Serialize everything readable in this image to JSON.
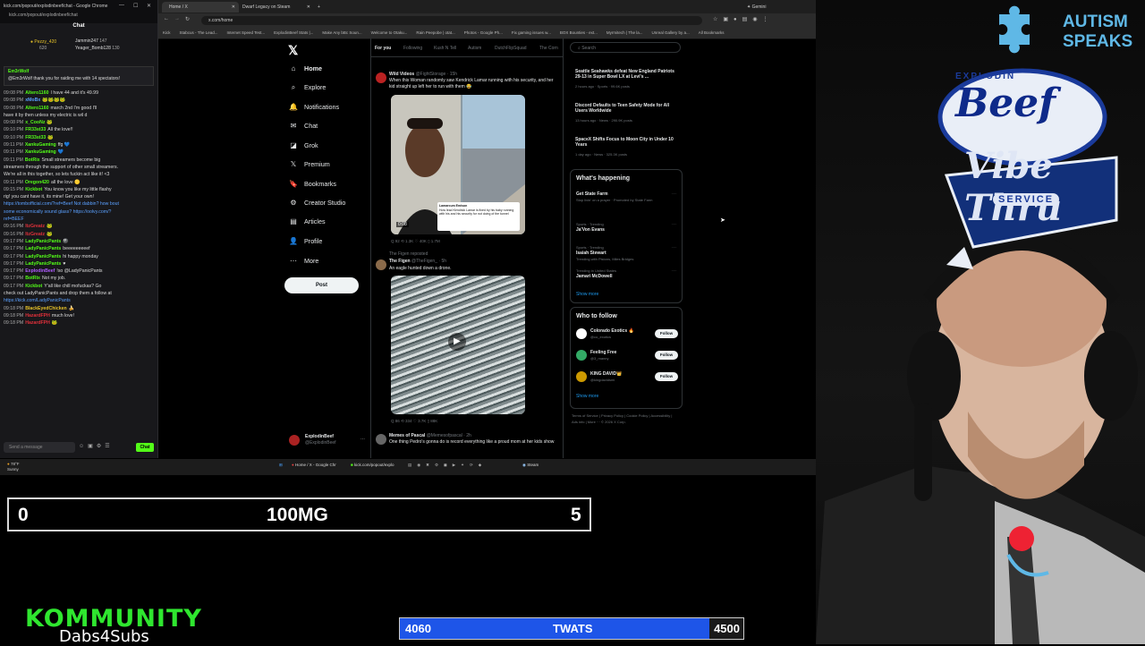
{
  "chat": {
    "window_title": "kick.com/popout/explodinbeef/chat - Google Chrome",
    "url": "kick.com/popout/explodinbeef/chat",
    "header": "Chat",
    "leaders": [
      "Pezzy_420",
      "Jammin247",
      "Yeager_Bomb128"
    ],
    "leader_counts": [
      "147",
      "130",
      "620"
    ],
    "pinned_user": "Em3rWolf",
    "pinned_text": "@Em3rWolf thank you for raiding me with 14 spectators!",
    "messages": [
      {
        "time": "09:08 PM",
        "user": "Altero1160",
        "text": "I have 44 and it's 49.99",
        "color": "#53fc18"
      },
      {
        "time": "09:08 PM",
        "user": "xMoBx",
        "text": "🐸🐸🐸🐸",
        "color": "#5aa0ff"
      },
      {
        "time": "09:08 PM",
        "user": "Altero1160",
        "text": "march 2nd I'm good I'll",
        "color": "#53fc18"
      },
      {
        "time": "",
        "user": "",
        "text": "have it by then unless my electric is wil d",
        "color": "#dcdcdc"
      },
      {
        "time": "09:08 PM",
        "user": "x_CooNz",
        "text": "🐸",
        "color": "#53fc18"
      },
      {
        "time": "09:10 PM",
        "user": "FR33st33",
        "text": "All the love!!",
        "color": "#53fc18"
      },
      {
        "time": "09:10 PM",
        "user": "FR33st33",
        "text": "🐸",
        "color": "#53fc18"
      },
      {
        "time": "09:11 PM",
        "user": "XankuGaming",
        "text": "ffg 💙",
        "color": "#53fc18"
      },
      {
        "time": "09:11 PM",
        "user": "XankuGaming",
        "text": "💙",
        "color": "#53fc18"
      },
      {
        "time": "09:11 PM",
        "user": "BotRix",
        "text": "Small streamers become big",
        "color": "#53fc18"
      },
      {
        "time": "",
        "user": "",
        "text": "streamers through the support of other small streamers.",
        "color": "#dcdcdc"
      },
      {
        "time": "",
        "user": "",
        "text": "We're all in this together, so lets fuckin act like it! <3",
        "color": "#dcdcdc"
      },
      {
        "time": "09:11 PM",
        "user": "Oregon420",
        "text": "all the love 🟡",
        "color": "#53fc18"
      },
      {
        "time": "09:15 PM",
        "user": "Kickbot",
        "text": "You know you like my little flashy",
        "color": "#53fc18"
      },
      {
        "time": "",
        "user": "",
        "text": "rig! you cant have it, its mine! Get your own!",
        "color": "#dcdcdc"
      },
      {
        "time": "",
        "user": "",
        "text": "https://tombofficial.com/?ref=Beef Not dabbin? how bout",
        "color": "#5aa0ff"
      },
      {
        "time": "",
        "user": "",
        "text": "some economically sound glass? https://oolvy.com/?",
        "color": "#5aa0ff"
      },
      {
        "time": "",
        "user": "",
        "text": "ref=BEEF",
        "color": "#5aa0ff"
      },
      {
        "time": "09:16 PM",
        "user": "ItzGreatz",
        "text": "🐸",
        "color": "#e0303a"
      },
      {
        "time": "09:16 PM",
        "user": "ItzGreatz",
        "text": "🐸",
        "color": "#e0303a"
      },
      {
        "time": "09:17 PM",
        "user": "LadyPanicPants",
        "text": "🎱",
        "color": "#53fc18"
      },
      {
        "time": "09:17 PM",
        "user": "LadyPanicPants",
        "text": "beeeeeeeeef",
        "color": "#53fc18"
      },
      {
        "time": "09:17 PM",
        "user": "LadyPanicPants",
        "text": "hi happy monday",
        "color": "#53fc18"
      },
      {
        "time": "09:17 PM",
        "user": "LadyPanicPants",
        "text": "♥",
        "color": "#53fc18"
      },
      {
        "time": "09:17 PM",
        "user": "ExplodinBeef",
        "text": "!so @LadyPanicPants",
        "color": "#b05cff"
      },
      {
        "time": "09:17 PM",
        "user": "BotRix",
        "text": "Not my job.",
        "color": "#53fc18"
      },
      {
        "time": "09:17 PM",
        "user": "Kickbot",
        "text": "Y'all like chill mofuckas? Go",
        "color": "#53fc18"
      },
      {
        "time": "",
        "user": "",
        "text": "check out LadyPanicPants and drop them a follow at",
        "color": "#dcdcdc"
      },
      {
        "time": "",
        "user": "",
        "text": "https://kick.com/LadyPanicPants",
        "color": "#5aa0ff"
      },
      {
        "time": "09:18 PM",
        "user": "BlackEyedChicken",
        "text": "🍌",
        "color": "#e6c229"
      },
      {
        "time": "09:18 PM",
        "user": "HazardFPH",
        "text": "much love!",
        "color": "#e0303a"
      },
      {
        "time": "09:18 PM",
        "user": "HazardFPH",
        "text": "🐸",
        "color": "#e0303a"
      }
    ],
    "input_placeholder": "Send a message",
    "send_label": "Chat"
  },
  "browser": {
    "tabs": [
      "Home / X",
      "Dwarf Legacy on Steam"
    ],
    "url": "x.com/home",
    "gemini_label": "Gemini",
    "bookmarks": [
      "Kick",
      "Stabcus - The Lead...",
      "Internet Speed Test...",
      "ExplodinBeef Stats |...",
      "Make Any bBc Soun...",
      "Welcome to Otaku...",
      "Rain Peepobe | otat...",
      "Photos - Google Ph...",
      "Fix gaming issues w...",
      "BOX Bounties - ext...",
      "Myrmitech | The la...",
      "Unreal Gallery by a...",
      "All Bookmarks"
    ]
  },
  "x": {
    "logo": "𝕏",
    "nav": [
      {
        "label": "Home",
        "icon": "⌂",
        "name": "home"
      },
      {
        "label": "Explore",
        "icon": "⌕",
        "name": "explore"
      },
      {
        "label": "Notifications",
        "icon": "🔔",
        "name": "notifications"
      },
      {
        "label": "Chat",
        "icon": "✉",
        "name": "chat"
      },
      {
        "label": "Grok",
        "icon": "◪",
        "name": "grok"
      },
      {
        "label": "Premium",
        "icon": "𝕏",
        "name": "premium"
      },
      {
        "label": "Bookmarks",
        "icon": "🔖",
        "name": "bookmarks"
      },
      {
        "label": "Creator Studio",
        "icon": "⚙",
        "name": "creator-studio"
      },
      {
        "label": "Articles",
        "icon": "▤",
        "name": "articles"
      },
      {
        "label": "Profile",
        "icon": "👤",
        "name": "profile"
      },
      {
        "label": "More",
        "icon": "⋯",
        "name": "more"
      }
    ],
    "post_label": "Post",
    "profile_name": "ExplodinBeef",
    "profile_handle": "@ExplodinBeef",
    "feed_tabs": [
      "For you",
      "Following",
      "Kush N Tell",
      "Autism",
      "DutchFlipSquad",
      "The Corn"
    ],
    "posts": [
      {
        "author": "Wild Videos",
        "handle": "@FightStorage · 15h",
        "text": "When this Woman randomly saw Kendrick Lamar running with his security, and her kid straight up left her to run with them 😂",
        "stats": "Q 92   ⟲ 1.3K   ♡ 40K   ▯ 1.7M",
        "duration": "0:08",
        "caption_title": "Lamarcum Emison",
        "caption_text": "How lead Kendrick Lamar is fixed by his baby running with his and his security for not doing of the tunnel"
      },
      {
        "author": "The Figen",
        "handle": "@TheFigen_ · 5h",
        "repost": "The Figen reposted",
        "text": "An eagle hunted down a drone.",
        "stats": "Q 86   ⟲ 334   ♡ 3.7K   ▯ 88K"
      },
      {
        "author": "Memes of Pascal",
        "handle": "@Memesofpascal · 2h",
        "text": "One thing Pedro's gonna do is record everything like a proud mom at her kids show"
      }
    ],
    "search_placeholder": "Search",
    "news": [
      {
        "title": "Seattle Seahawks defeat New England Patriots 29-13 in Super Bowl LX at Levi's ...",
        "meta": "2 hours ago · Sports · 99.6K posts"
      },
      {
        "title": "Discord Defaults to Teen Safety Mode for All Users Worldwide",
        "meta": "13 hours ago · News · 290.9K posts"
      },
      {
        "title": "SpaceX Shifts Focus to Moon City in Under 10 Years",
        "meta": "1 day ago · News · 325.3K posts"
      }
    ],
    "happening_title": "What's happening",
    "trends": [
      {
        "context": "",
        "name": "Get State Farm",
        "sub": "Stop livin' on a prayer · Promoted by State Farm"
      },
      {
        "context": "Sports · Trending",
        "name": "Ja'Von Evans",
        "sub": ""
      },
      {
        "context": "Sports · Trending",
        "name": "Isaiah Stewart",
        "sub": "Trending with Pistons, Miles Bridges"
      },
      {
        "context": "Trending in United States",
        "name": "Jamari McDowell",
        "sub": ""
      }
    ],
    "show_more": "Show more",
    "who_title": "Who to follow",
    "follow": [
      {
        "name": "Colorado Exotics 🔥",
        "handle": "@co_exotics"
      },
      {
        "name": "Feeling Free",
        "handle": "@3_manny"
      },
      {
        "name": "KING DAVID👑",
        "handle": "@kingdavidsmi"
      }
    ],
    "follow_label": "Follow",
    "footer": "Terms of Service  |  Privacy Policy  |  Cookie Policy  |  Accessibility  |  Ads info  |  More ···  © 2026 X Corp."
  },
  "taskbar": {
    "weather_temp": "78°F",
    "weather_desc": "Sunny",
    "apps": [
      "Home / X - Google Chr",
      "kick.com/popout/explo",
      "Steam"
    ]
  },
  "overlay": {
    "goal_left": "0",
    "goal_center": "100MG",
    "goal_right": "5",
    "twats_current": "4060",
    "twats_label": "TWATS",
    "twats_goal": "4500",
    "twats_progress": 0.902,
    "kommunity_title": "KOMMUNITY",
    "kommunity_sub": "Dabs4Subs",
    "autism_speaks_line1": "AUTISM",
    "autism_speaks_line2": "SPEAKS",
    "sign_top": "EXPLODIN",
    "sign_beef": "Beef",
    "sign_vibe": "Vibe Thru",
    "sign_service": "SERVICE"
  }
}
